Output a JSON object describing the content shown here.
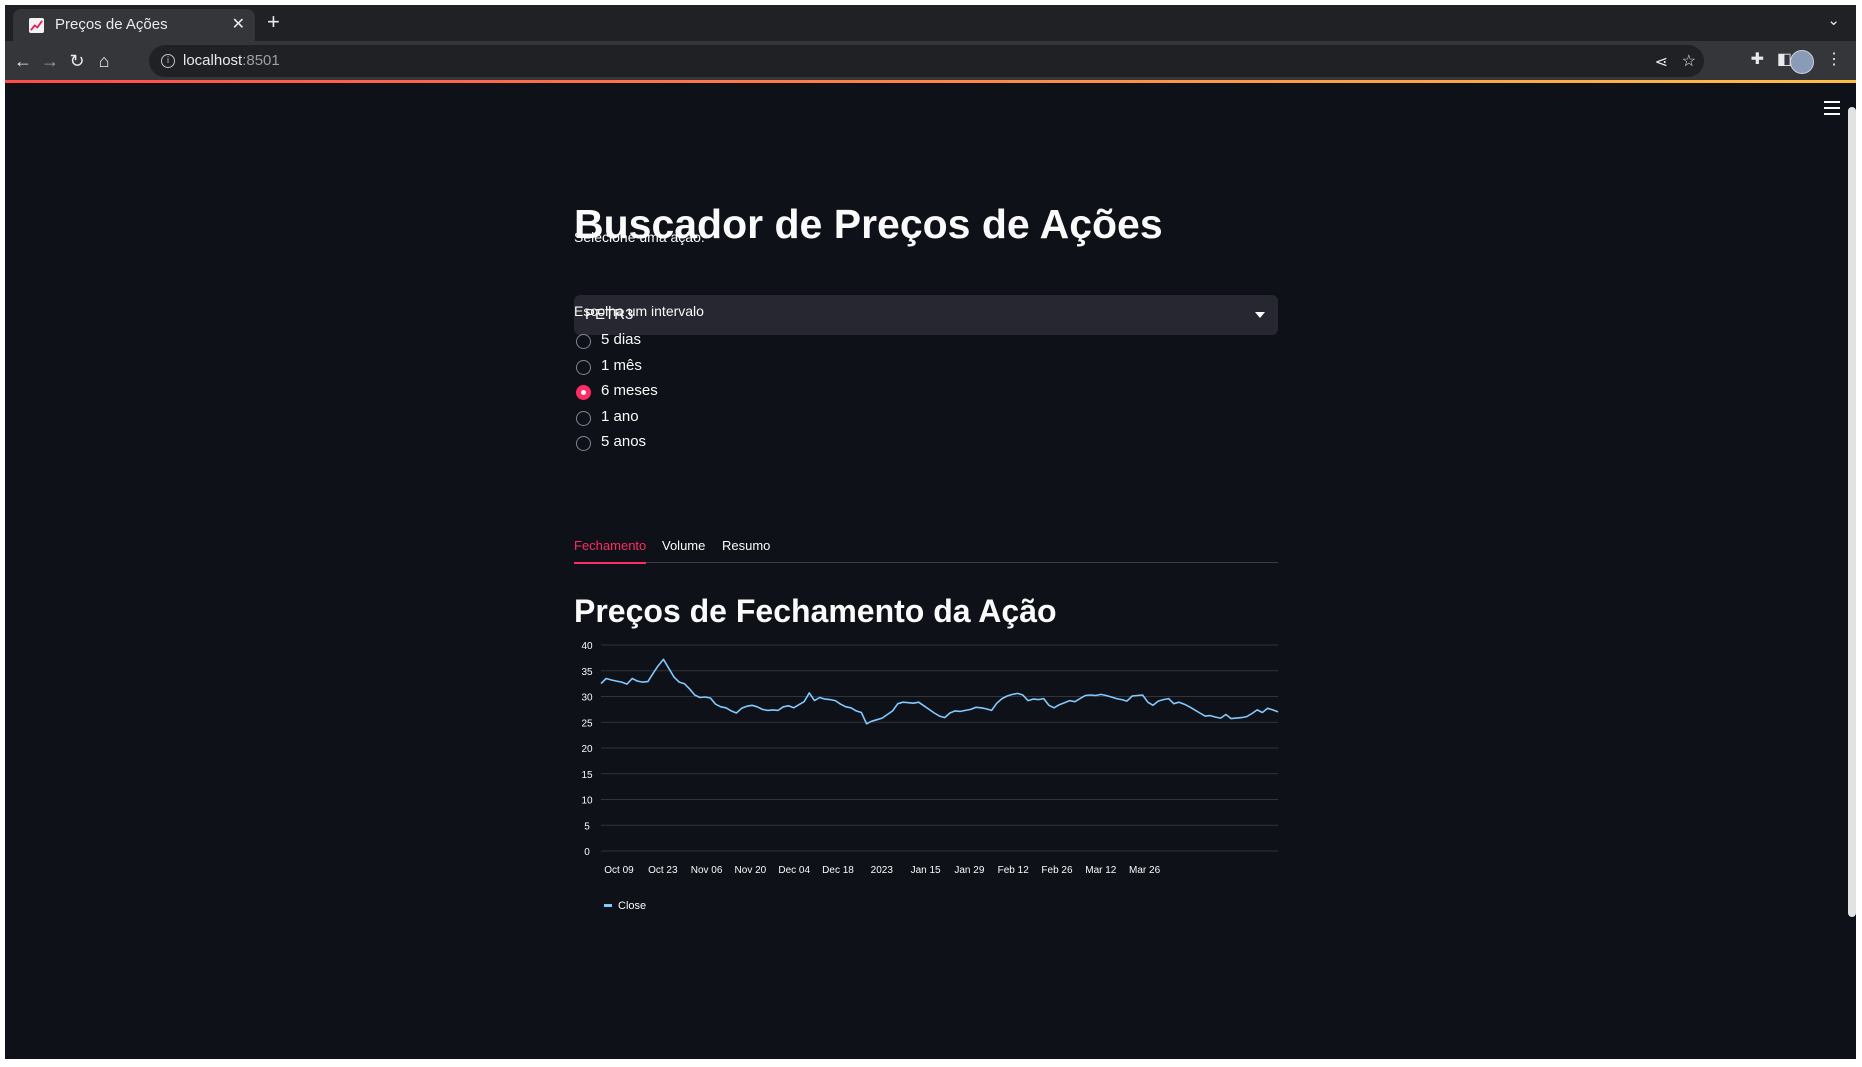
{
  "browser": {
    "tab_title": "Preços de Ações",
    "new_tab": "+",
    "url_host": "localhost",
    "url_port": ":8501"
  },
  "app": {
    "title": "Buscador de Preços de Ações",
    "select_label": "Selecione uma ação:",
    "selected_stock": "PETR3",
    "interval_label": "Escolha um intervalo",
    "intervals": [
      {
        "label": "5 dias",
        "selected": false
      },
      {
        "label": "1 mês",
        "selected": false
      },
      {
        "label": "6 meses",
        "selected": true
      },
      {
        "label": "1 ano",
        "selected": false
      },
      {
        "label": "5 anos",
        "selected": false
      }
    ],
    "tabs": [
      {
        "label": "Fechamento",
        "active": true
      },
      {
        "label": "Volume",
        "active": false
      },
      {
        "label": "Resumo",
        "active": false
      }
    ],
    "section_title": "Preços de Fechamento da Ação"
  },
  "colors": {
    "accent": "#ff2b64",
    "background": "#0e1117",
    "line": "#83c9ff"
  },
  "chart_data": {
    "type": "line",
    "title": "",
    "ylim": [
      0,
      40
    ],
    "yticks": [
      0,
      5,
      10,
      15,
      20,
      25,
      30,
      35,
      40
    ],
    "xtick_labels": [
      "Oct 09",
      "Oct 23",
      "Nov 06",
      "Nov 20",
      "Dec 04",
      "Dec 18",
      "2023",
      "Jan 15",
      "Jan 29",
      "Feb 12",
      "Feb 26",
      "Mar 12",
      "Mar 26"
    ],
    "grid": true,
    "legend": "bottom-left",
    "series": [
      {
        "name": "Close",
        "values": [
          32.5,
          33.5,
          33.2,
          33.0,
          32.8,
          32.4,
          33.5,
          33.0,
          32.8,
          32.9,
          34.5,
          36.0,
          37.2,
          35.5,
          33.8,
          32.8,
          32.5,
          31.5,
          30.3,
          29.8,
          29.9,
          29.7,
          28.5,
          28.0,
          27.8,
          27.2,
          26.8,
          27.7,
          28.1,
          28.3,
          28.0,
          27.5,
          27.3,
          27.4,
          27.3,
          28.0,
          28.2,
          27.8,
          28.4,
          29.0,
          30.7,
          29.2,
          29.8,
          29.5,
          29.4,
          29.2,
          28.5,
          28.0,
          27.8,
          27.2,
          26.9,
          24.7,
          25.2,
          25.5,
          25.8,
          26.5,
          27.2,
          28.6,
          28.9,
          28.8,
          28.7,
          28.9,
          28.2,
          27.5,
          26.8,
          26.2,
          25.9,
          26.8,
          27.2,
          27.1,
          27.3,
          27.5,
          27.9,
          27.8,
          27.6,
          27.3,
          28.7,
          29.6,
          30.1,
          30.4,
          30.6,
          30.3,
          29.2,
          29.5,
          29.4,
          29.6,
          28.3,
          27.8,
          28.4,
          28.8,
          29.2,
          29.0,
          29.6,
          30.2,
          30.3,
          30.2,
          30.4,
          30.2,
          29.9,
          29.6,
          29.4,
          29.1,
          30.1,
          30.2,
          30.3,
          28.9,
          28.3,
          29.1,
          29.4,
          29.6,
          28.6,
          28.9,
          28.5,
          28.0,
          27.4,
          26.8,
          26.2,
          26.3,
          26.0,
          25.8,
          26.5,
          25.7,
          25.8,
          25.9,
          26.1,
          26.7,
          27.4,
          26.9,
          27.7,
          27.4,
          27.0
        ]
      }
    ]
  }
}
